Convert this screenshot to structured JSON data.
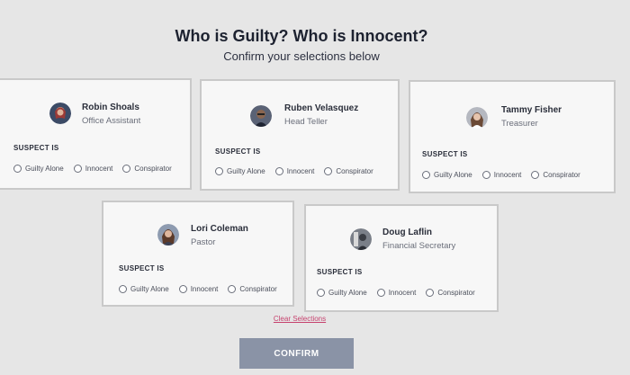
{
  "header": {
    "title": "Who is Guilty? Who is Innocent?",
    "subtitle": "Confirm your selections below"
  },
  "suspect_label": "SUSPECT IS",
  "options": [
    "Guilty Alone",
    "Innocent",
    "Conspirator"
  ],
  "suspects": [
    {
      "name": "Robin Shoals",
      "role": "Office Assistant"
    },
    {
      "name": "Ruben Velasquez",
      "role": "Head Teller"
    },
    {
      "name": "Tammy Fisher",
      "role": "Treasurer"
    },
    {
      "name": "Lori Coleman",
      "role": "Pastor"
    },
    {
      "name": "Doug Laflin",
      "role": "Financial Secretary"
    }
  ],
  "actions": {
    "clear_label": "Clear Selections",
    "confirm_label": "CONFIRM"
  }
}
